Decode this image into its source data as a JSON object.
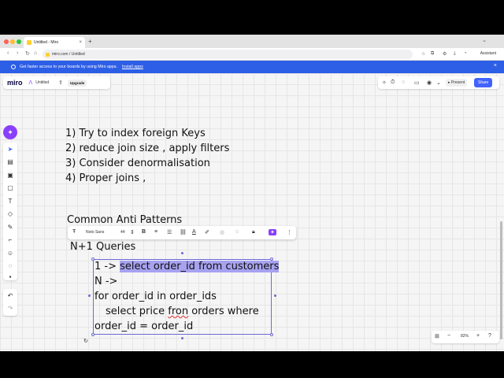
{
  "browser": {
    "tab_title": "Untitled - Miro",
    "tab_close": "×",
    "new_tab": "+",
    "url": "miro.com / Untitled",
    "assistant": "Assistant"
  },
  "banner": {
    "text": "Get faster access to your boards by using Miro apps.",
    "link": "Install apps",
    "close": "×"
  },
  "topbar": {
    "logo": "miro",
    "board_title": "Untitled",
    "upgrade": "Upgrade",
    "present": "Present",
    "share": "Share"
  },
  "canvas": {
    "list": [
      "1) Try to index foreign Keys",
      "2) reduce join size , apply filters",
      "3) Consider denormalisation",
      "4) Proper joins ,"
    ],
    "anti_patterns_title": "Common Anti Patterns",
    "nplus1": "N+1 Queries",
    "code": {
      "line1_prefix": "1 -> ",
      "line1_highlight": "select order_id from customers",
      "line2": "N ->",
      "line3": "for order_id in order_ids",
      "line4_a": "select price ",
      "line4_misspelled": "fron",
      "line4_b": " orders where",
      "line5": "order_id = order_id"
    }
  },
  "format_toolbar": {
    "font": "Noto Sans",
    "size": "44"
  },
  "zoom": {
    "level": "82%"
  },
  "colors": {
    "accent": "#4262ff",
    "banner": "#2d5ee6",
    "highlight": "#a7a2f0",
    "ai_purple": "#8a3ffc"
  }
}
